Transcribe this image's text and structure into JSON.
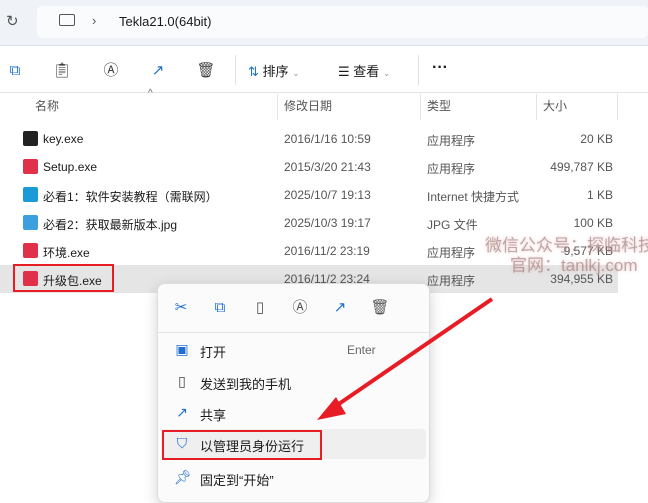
{
  "address": {
    "crumb": "Tekla21.0(64bit)"
  },
  "toolbar": {
    "sort": "排序",
    "view": "查看",
    "more": "···"
  },
  "columns": {
    "name": "名称",
    "date": "修改日期",
    "type": "类型",
    "size": "大小"
  },
  "files": [
    {
      "name": "key.exe",
      "date": "2016/1/16 10:59",
      "type": "应用程序",
      "size": "20 KB",
      "icon": "key-app-icon",
      "color": "#222"
    },
    {
      "name": "Setup.exe",
      "date": "2015/3/20 21:43",
      "type": "应用程序",
      "size": "499,787 KB",
      "icon": "tekla-app-icon",
      "color": "#e0304a"
    },
    {
      "name": "必看1：软件安装教程（需联网）",
      "date": "2025/10/7 19:13",
      "type": "Internet 快捷方式",
      "size": "1 KB",
      "icon": "edge-shortcut-icon",
      "color": "#1a9bd8"
    },
    {
      "name": "必看2：获取最新版本.jpg",
      "date": "2025/10/3 19:17",
      "type": "JPG 文件",
      "size": "100 KB",
      "icon": "image-file-icon",
      "color": "#3aa0e0"
    },
    {
      "name": "环境.exe",
      "date": "2016/11/2 23:19",
      "type": "应用程序",
      "size": "9,577 KB",
      "icon": "tekla-app-icon",
      "color": "#e0304a"
    },
    {
      "name": "升级包.exe",
      "date": "2016/11/2 23:24",
      "type": "应用程序",
      "size": "394,955 KB",
      "icon": "tekla-app-icon",
      "color": "#e0304a"
    }
  ],
  "context_menu": {
    "items": [
      {
        "label": "打开",
        "shortcut": "Enter",
        "icon": "open-icon"
      },
      {
        "label": "发送到我的手机",
        "icon": "phone-icon"
      },
      {
        "label": "共享",
        "icon": "share-icon"
      },
      {
        "label": "以管理员身份运行",
        "icon": "shield-icon"
      },
      {
        "label": "固定到“开始”",
        "icon": "pin-icon"
      }
    ]
  },
  "watermark": {
    "line1": "微信公众号：探临科技",
    "line2": "官网：tanlkj.com"
  },
  "colors": {
    "highlight": "#e81c24",
    "selected": "#e5e5e5"
  }
}
